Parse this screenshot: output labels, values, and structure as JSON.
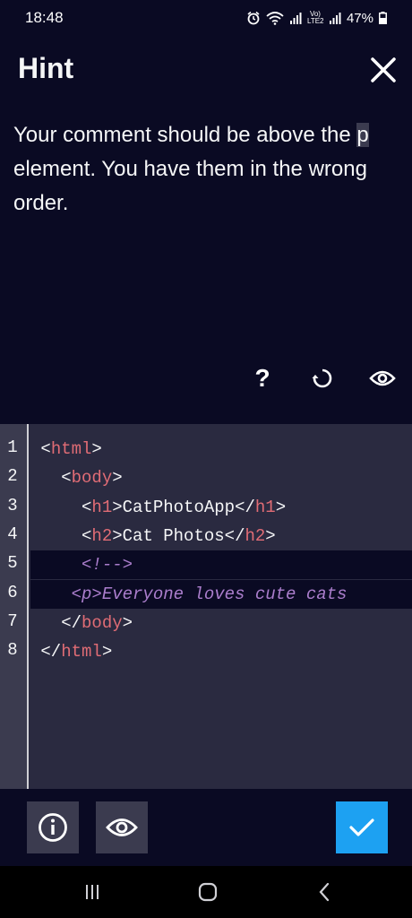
{
  "status_bar": {
    "time": "18:48",
    "lte_label": "Vo)\nLTE2",
    "battery_text": "47%"
  },
  "hint": {
    "title": "Hint",
    "message_part1": "Your comment should be above the ",
    "message_cursor_char": "p",
    "message_part2": " element. You have them in the wrong order."
  },
  "actions": {
    "help_glyph": "?"
  },
  "editor": {
    "lines": [
      {
        "num": "1",
        "indent": " ",
        "open": "<",
        "tag": "html",
        "close": ">",
        "text": "",
        "etag_open": "",
        "etag": "",
        "etag_close": ""
      },
      {
        "num": "2",
        "indent": "   ",
        "open": "<",
        "tag": "body",
        "close": ">",
        "text": "",
        "etag_open": "",
        "etag": "",
        "etag_close": ""
      },
      {
        "num": "3",
        "indent": "     ",
        "open": "<",
        "tag": "h1",
        "close": ">",
        "text": "CatPhotoApp",
        "etag_open": "</",
        "etag": "h1",
        "etag_close": ">"
      },
      {
        "num": "4",
        "indent": "     ",
        "open": "<",
        "tag": "h2",
        "close": ">",
        "text": "Cat Photos",
        "etag_open": "</",
        "etag": "h2",
        "etag_close": ">"
      },
      {
        "num": "5",
        "comment": "     <!-->"
      },
      {
        "num": "6",
        "comment": "    <p>Everyone loves cute cats"
      },
      {
        "num": "7",
        "indent": "   ",
        "open": "</",
        "tag": "body",
        "close": ">",
        "text": "",
        "etag_open": "",
        "etag": "",
        "etag_close": ""
      },
      {
        "num": "8",
        "indent": " ",
        "open": "</",
        "tag": "html",
        "close": ">",
        "text": "",
        "etag_open": "",
        "etag": "",
        "etag_close": ""
      }
    ]
  },
  "colors": {
    "background": "#0a0a23",
    "editor_bg": "#2a2a40",
    "tag_name": "#e06c75",
    "comment": "#c792ea",
    "submit": "#1da1f2"
  },
  "icons": {
    "close": "close-icon",
    "help": "question-icon",
    "reset": "reset-icon",
    "preview": "eye-icon",
    "info": "info-icon",
    "check": "check-icon"
  }
}
